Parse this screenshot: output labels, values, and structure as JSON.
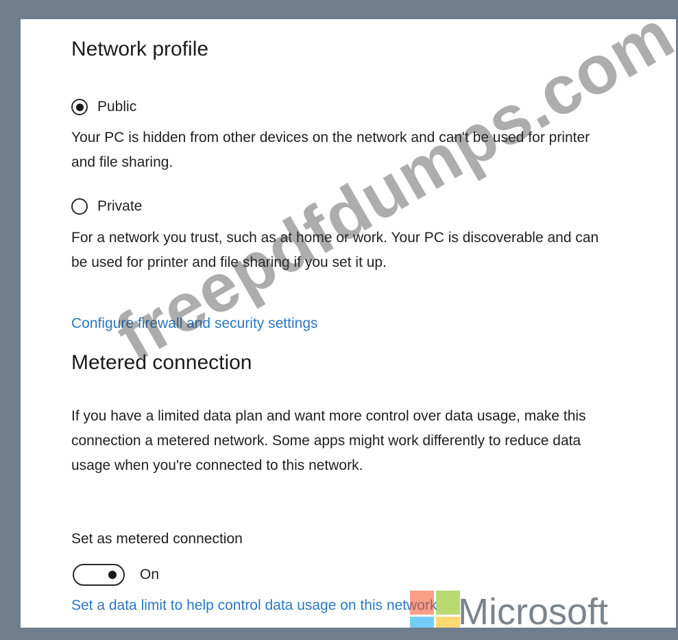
{
  "network_profile": {
    "heading": "Network profile",
    "options": [
      {
        "label": "Public",
        "selected": true,
        "description": "Your PC is hidden from other devices on the network and can't be used for printer and file sharing."
      },
      {
        "label": "Private",
        "selected": false,
        "description": "For a network you trust, such as at home or work. Your PC is discoverable and can be used for printer and file sharing if you set it up."
      }
    ],
    "firewall_link": "Configure firewall and security settings"
  },
  "metered_connection": {
    "heading": "Metered connection",
    "description": "If you have a limited data plan and want more control over data usage, make this connection a metered network. Some apps might work differently to reduce data usage when you're connected to this network.",
    "toggle_label": "Set as metered connection",
    "toggle_on": true,
    "toggle_state": "On",
    "data_limit_link": "Set a data limit to help control data usage on this network"
  },
  "watermark": {
    "text": "freepdfdumps.com"
  },
  "logo": {
    "text": "Microsoft",
    "colors": [
      "#f25022",
      "#7fba00",
      "#00a4ef",
      "#ffb900"
    ]
  },
  "colors": {
    "link": "#2a78c2",
    "frame": "#6f7d8d"
  }
}
